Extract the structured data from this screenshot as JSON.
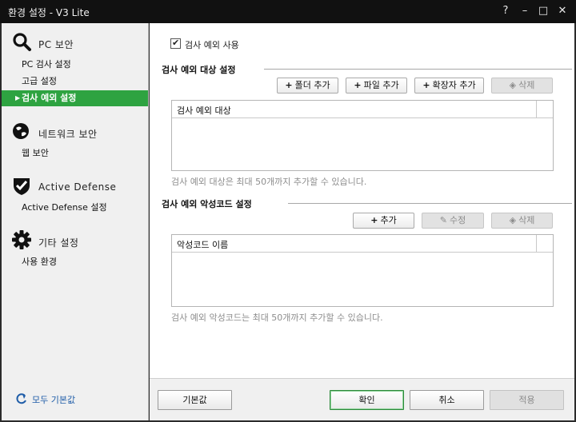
{
  "window": {
    "title": "환경 설정 - V3 Lite",
    "controls": {
      "help": "?",
      "minimize": "–",
      "maximize": "□",
      "close": "✕"
    }
  },
  "sidebar": {
    "sections": [
      {
        "icon": "magnifier-icon",
        "title": "PC 보안",
        "items": [
          "PC 검사 설정",
          "고급 설정",
          "검사 예외 설정"
        ]
      },
      {
        "icon": "globe-icon",
        "title": "네트워크 보안",
        "items": [
          "웹 보안"
        ]
      },
      {
        "icon": "shield-check-icon",
        "title": "Active Defense",
        "items": [
          "Active Defense 설정"
        ]
      },
      {
        "icon": "gear-icon",
        "title": "기타 설정",
        "items": [
          "사용 환경"
        ]
      }
    ],
    "active_item": "검사 예외 설정",
    "reset_all": "모두 기본값"
  },
  "main": {
    "enable_checkbox": {
      "label": "검사 예외 사용",
      "checked": true
    },
    "targets": {
      "title": "검사 예외 대상 설정",
      "buttons": {
        "add_folder": "폴더 추가",
        "add_file": "파일 추가",
        "add_extension": "확장자 추가",
        "delete": "삭제"
      },
      "column": "검사 예외 대상",
      "hint": "검사 예외 대상은 최대 50개까지 추가할 수 있습니다."
    },
    "malware": {
      "title": "검사 예외 악성코드 설정",
      "buttons": {
        "add": "추가",
        "edit": "수정",
        "delete": "삭제"
      },
      "column": "악성코드 이름",
      "hint": "검사 예외 악성코드는 최대 50개까지 추가할 수 있습니다."
    }
  },
  "footer": {
    "default": "기본값",
    "ok": "확인",
    "cancel": "취소",
    "apply": "적용"
  },
  "colors": {
    "accent": "#2ea341",
    "link": "#1f5da8",
    "titlebar": "#111111"
  }
}
